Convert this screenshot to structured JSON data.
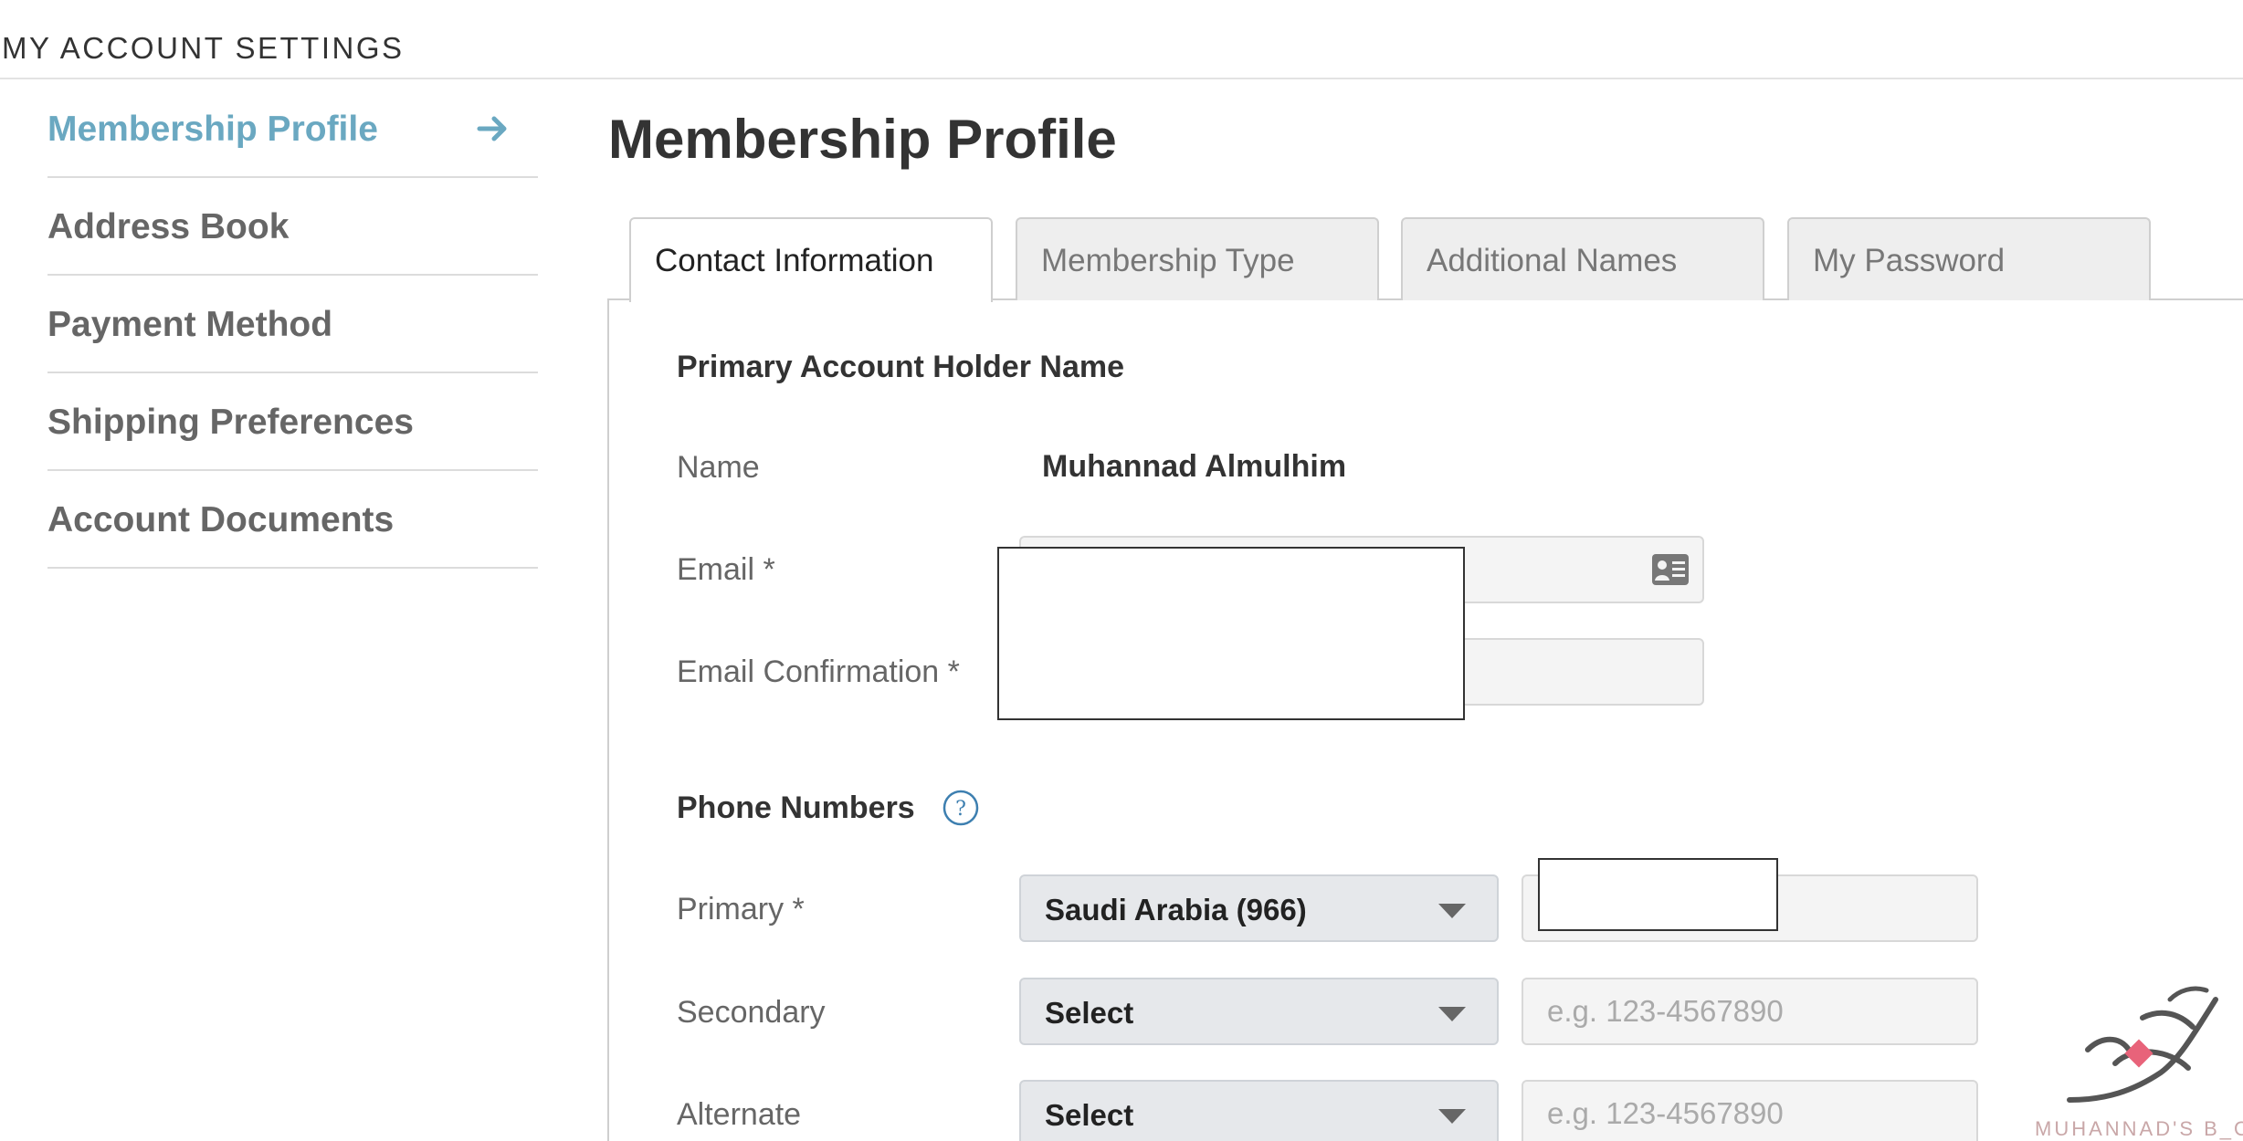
{
  "header": {
    "title": "MY ACCOUNT SETTINGS"
  },
  "sidebar": {
    "items": [
      {
        "label": "Membership Profile",
        "active": true
      },
      {
        "label": "Address Book"
      },
      {
        "label": "Payment Method"
      },
      {
        "label": "Shipping Preferences"
      },
      {
        "label": "Account Documents"
      }
    ],
    "active_color": "#6aa8c1"
  },
  "main": {
    "title": "Membership Profile",
    "tabs": [
      {
        "label": "Contact Information",
        "active": true
      },
      {
        "label": "Membership Type"
      },
      {
        "label": "Additional Names"
      },
      {
        "label": "My Password"
      }
    ]
  },
  "form": {
    "name_section": {
      "title": "Primary Account Holder Name",
      "name_label": "Name",
      "name_value": "Muhannad Almulhim",
      "email_label": "Email *",
      "email_value": "",
      "email_confirm_label": "Email Confirmation *",
      "email_confirm_value": ""
    },
    "phone_section": {
      "title": "Phone Numbers",
      "primary_label": "Primary *",
      "primary_country": "Saudi Arabia (966)",
      "primary_number": "",
      "secondary_label": "Secondary",
      "secondary_country": "Select",
      "secondary_placeholder": "e.g. 123-4567890",
      "alternate_label": "Alternate",
      "alternate_country": "Select",
      "alternate_placeholder": "e.g. 123-4567890"
    }
  },
  "icons": {
    "arrow": "arrow-right-icon",
    "help": "question-circle-icon",
    "contact_card": "contact-card-icon",
    "caret": "caret-down-icon"
  },
  "watermark": {
    "text": "MUHANNAD'S B_OG"
  }
}
